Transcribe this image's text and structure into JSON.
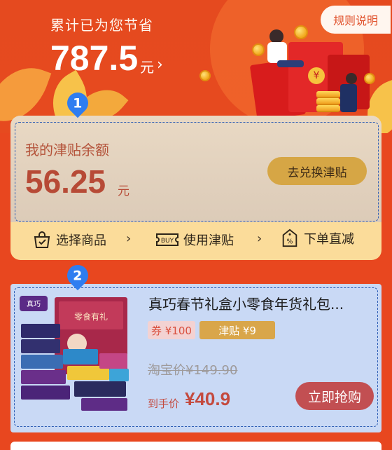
{
  "header": {
    "savings_label": "累计已为您节省",
    "savings_amount": "787.5",
    "savings_unit": "元",
    "savings_chevron": "›",
    "rules_button": "规则说明"
  },
  "markers": [
    "1",
    "2"
  ],
  "balance": {
    "title": "我的津贴余额",
    "amount": "56.25",
    "unit": "元",
    "redeem_button": "去兑换津贴"
  },
  "steps": [
    {
      "label": "选择商品",
      "icon": "shopping-bag-icon"
    },
    {
      "label": "使用津贴",
      "icon": "buy-ticket-icon"
    },
    {
      "label": "下单直减",
      "icon": "discount-tag-icon"
    }
  ],
  "step_arrow": "›",
  "product": {
    "title": "真巧春节礼盒小零食年货礼包...",
    "coupon": "券 ¥100",
    "subsidy": "津贴 ¥9",
    "original_price": "淘宝价¥149.90",
    "final_label": "到手价",
    "final_price": "¥40.9",
    "buy_button": "立即抢购",
    "box_label": "零食有礼",
    "brand": "真巧"
  },
  "colors": {
    "background": "#e8471f",
    "balance_card": "#fbdc9a",
    "redeem_button": "#d6a645",
    "buy_button": "#c24f52",
    "marker": "#2f7df0"
  }
}
